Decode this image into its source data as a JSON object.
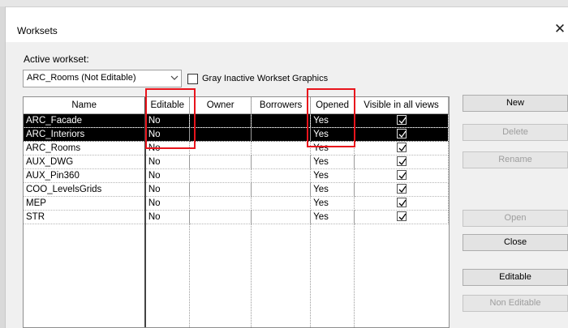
{
  "window": {
    "title": "Worksets",
    "close_glyph": "✕"
  },
  "active_workset": {
    "label": "Active workset:",
    "value": "ARC_Rooms (Not Editable)",
    "gray_inactive_label": "Gray Inactive Workset Graphics",
    "gray_inactive_checked": false
  },
  "table": {
    "headers": {
      "name": "Name",
      "editable": "Editable",
      "owner": "Owner",
      "borrowers": "Borrowers",
      "opened": "Opened",
      "visible": "Visible in all views"
    },
    "rows": [
      {
        "name": "ARC_Facade",
        "editable": "No",
        "owner": "",
        "borrowers": "",
        "opened": "Yes",
        "visible": true,
        "selected": true
      },
      {
        "name": "ARC_Interiors",
        "editable": "No",
        "owner": "",
        "borrowers": "",
        "opened": "Yes",
        "visible": true,
        "selected": true
      },
      {
        "name": "ARC_Rooms",
        "editable": "No",
        "owner": "",
        "borrowers": "",
        "opened": "Yes",
        "visible": true,
        "selected": false
      },
      {
        "name": "AUX_DWG",
        "editable": "No",
        "owner": "",
        "borrowers": "",
        "opened": "Yes",
        "visible": true,
        "selected": false
      },
      {
        "name": "AUX_Pin360",
        "editable": "No",
        "owner": "",
        "borrowers": "",
        "opened": "Yes",
        "visible": true,
        "selected": false
      },
      {
        "name": "COO_LevelsGrids",
        "editable": "No",
        "owner": "",
        "borrowers": "",
        "opened": "Yes",
        "visible": true,
        "selected": false
      },
      {
        "name": "MEP",
        "editable": "No",
        "owner": "",
        "borrowers": "",
        "opened": "Yes",
        "visible": true,
        "selected": false
      },
      {
        "name": "STR",
        "editable": "No",
        "owner": "",
        "borrowers": "",
        "opened": "Yes",
        "visible": true,
        "selected": false
      }
    ]
  },
  "buttons": {
    "new": "New",
    "delete": "Delete",
    "rename": "Rename",
    "open": "Open",
    "close": "Close",
    "editable": "Editable",
    "non_editable": "Non Editable"
  },
  "annotation_color": "#e8141c",
  "selection_color": "#000000"
}
